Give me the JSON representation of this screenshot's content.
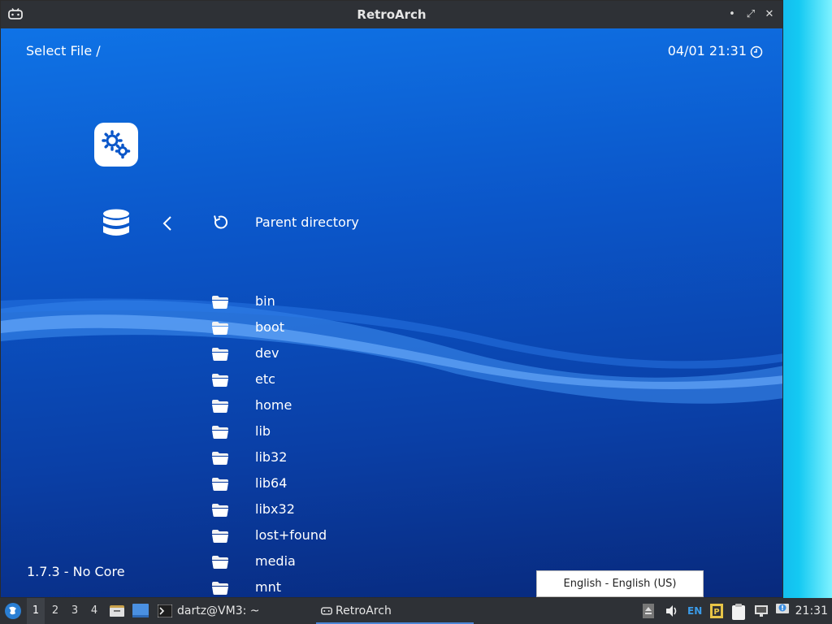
{
  "window": {
    "title": "RetroArch",
    "controls": {
      "minimize": "•",
      "maximize": "⤢",
      "close": "✕"
    }
  },
  "header": {
    "title": "Select File /",
    "clock": "04/01 21:31"
  },
  "menu": {
    "parent_label": "Parent directory",
    "files": [
      "bin",
      "boot",
      "dev",
      "etc",
      "home",
      "lib",
      "lib32",
      "lib64",
      "libx32",
      "lost+found",
      "media",
      "mnt"
    ]
  },
  "footer": {
    "version": "1.7.3 - No Core"
  },
  "tooltip": {
    "text": "English - English (US)"
  },
  "taskbar": {
    "workspaces": [
      "1",
      "2",
      "3",
      "4"
    ],
    "terminal_task": "dartz@VM3: ~",
    "app_task": "RetroArch",
    "lang": "EN",
    "clock": "21:31"
  },
  "colors": {
    "accent": "#0a56c9",
    "titlebar": "#2e3136",
    "task_underline": "#4b86d6"
  }
}
